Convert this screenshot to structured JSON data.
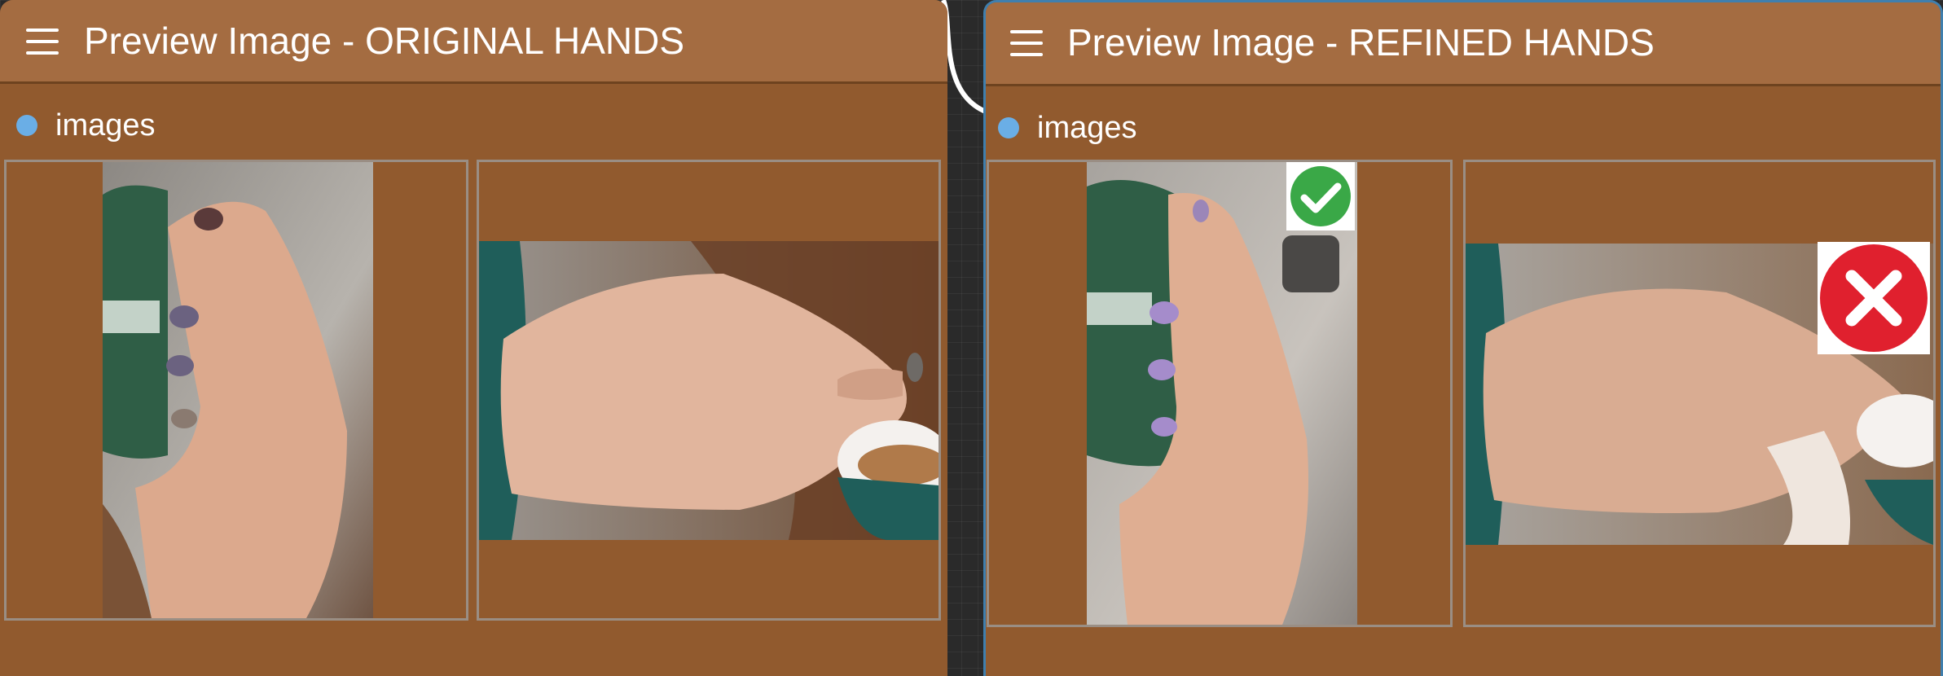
{
  "nodes": {
    "left": {
      "title": "Preview Image - ORIGINAL HANDS",
      "output_label": "images",
      "images": [
        {
          "name": "original-hand-cup-portrait"
        },
        {
          "name": "original-hand-cup-landscape"
        }
      ]
    },
    "right": {
      "title": "Preview Image - REFINED HANDS",
      "output_label": "images",
      "images": [
        {
          "name": "refined-hand-cup-portrait",
          "badge": "check-icon"
        },
        {
          "name": "refined-hand-cup-landscape",
          "badge": "x-icon"
        }
      ]
    }
  },
  "colors": {
    "node_body": "#915a2e",
    "node_header": "#a46c41",
    "slot_dot": "#6aaee6",
    "selection_border": "#3f7fae",
    "check_badge": "#3aa847",
    "x_badge": "#e0202e"
  }
}
